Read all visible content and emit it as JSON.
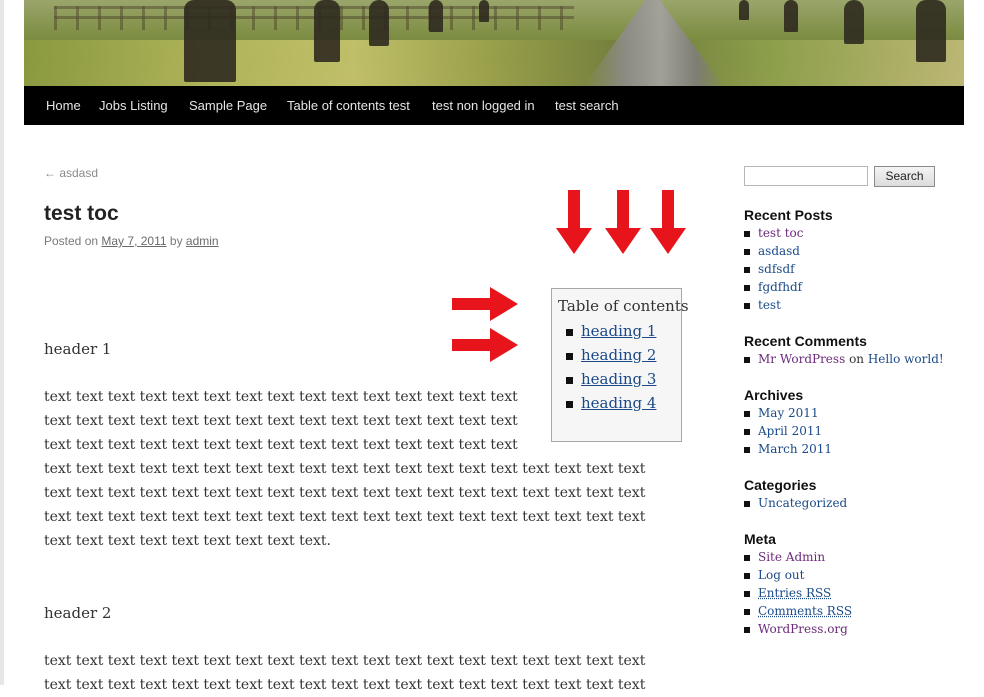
{
  "nav": {
    "items": [
      {
        "label": "Home"
      },
      {
        "label": "Jobs Listing"
      },
      {
        "label": "Sample Page"
      },
      {
        "label": "Table of contents test"
      },
      {
        "label": "test non logged in"
      },
      {
        "label": "test search"
      }
    ]
  },
  "post": {
    "prev_link": "← asdasd",
    "title": "test toc",
    "meta_prefix": "Posted on",
    "date": "May 7, 2011",
    "by": "by",
    "author": "admin"
  },
  "toc": {
    "title": "Table of contents",
    "items": [
      "heading 1",
      "heading 2",
      "heading 3",
      "heading 4"
    ]
  },
  "content": {
    "header1": "header 1",
    "paragraph1_lines": [
      "text text text text text text text text text text text text text text text",
      "text text text text text text text text text text text text text text text",
      "text text text text text text text text text text text text text text text",
      "text text text text text text text text text text text text text text text text text text text",
      "text text text text text text text text text text text text text text text text text text text",
      "text text text text text text text text text text text text text text text text text text text",
      "text text text text text text text text text."
    ],
    "header2": "header 2",
    "paragraph2_lines": [
      "text text text text text text text text text text text text text text text text text text text",
      "text text text text text text text text text text text text text text text text text text text"
    ]
  },
  "sidebar": {
    "search": {
      "button_label": "Search",
      "value": ""
    },
    "recent_posts": {
      "title": "Recent Posts",
      "items": [
        "test toc",
        "asdasd",
        "sdfsdf",
        "fgdfhdf",
        "test"
      ]
    },
    "recent_comments": {
      "title": "Recent Comments",
      "comment": {
        "author": "Mr WordPress",
        "on": "on",
        "post": "Hello world!"
      }
    },
    "archives": {
      "title": "Archives",
      "items": [
        "May 2011",
        "April 2011",
        "March 2011"
      ]
    },
    "categories": {
      "title": "Categories",
      "items": [
        "Uncategorized"
      ]
    },
    "meta": {
      "title": "Meta",
      "items": [
        "Site Admin",
        "Log out",
        "Entries RSS",
        "Comments RSS",
        "WordPress.org"
      ]
    }
  },
  "colors": {
    "nav_bg": "#000000",
    "link": "#1a4a88",
    "visited_link": "#6b2a7a",
    "annotation_arrow": "#e8141b"
  },
  "icons": {
    "down_arrows": [
      "down-arrow-icon",
      "down-arrow-icon",
      "down-arrow-icon"
    ],
    "right_arrows": [
      "right-arrow-icon",
      "right-arrow-icon"
    ]
  }
}
